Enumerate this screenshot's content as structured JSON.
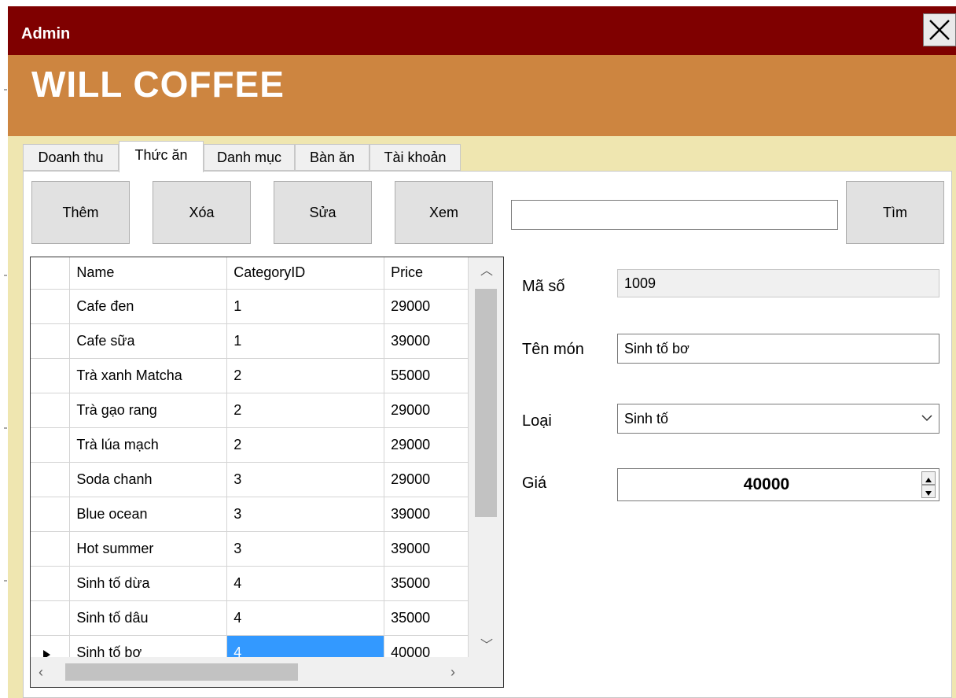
{
  "window": {
    "title": "Admin"
  },
  "banner": {
    "title": "WILL COFFEE"
  },
  "tabs": [
    {
      "label": "Doanh thu",
      "active": false
    },
    {
      "label": "Thức ăn",
      "active": true
    },
    {
      "label": "Danh mục",
      "active": false
    },
    {
      "label": "Bàn ăn",
      "active": false
    },
    {
      "label": "Tài khoản",
      "active": false
    }
  ],
  "toolbar": {
    "add_label": "Thêm",
    "delete_label": "Xóa",
    "edit_label": "Sửa",
    "view_label": "Xem",
    "search_value": "",
    "search_label": "Tìm"
  },
  "grid": {
    "columns": [
      "Name",
      "CategoryID",
      "Price"
    ],
    "rows": [
      [
        "Cafe đen",
        "1",
        "29000"
      ],
      [
        "Cafe sữa",
        "1",
        "39000"
      ],
      [
        "Trà xanh Matcha",
        "2",
        "55000"
      ],
      [
        "Trà gạo rang",
        "2",
        "29000"
      ],
      [
        "Trà lúa mạch",
        "2",
        "29000"
      ],
      [
        "Soda chanh",
        "3",
        "29000"
      ],
      [
        "Blue ocean",
        "3",
        "39000"
      ],
      [
        "Hot summer",
        "3",
        "39000"
      ],
      [
        "Sinh tố dừa",
        "4",
        "35000"
      ],
      [
        "Sinh tố dâu",
        "4",
        "35000"
      ],
      [
        "Sinh tố bơ",
        "4",
        "40000"
      ]
    ],
    "current_row": 10,
    "selected_column": 1
  },
  "form": {
    "id_label": "Mã số",
    "id_value": "1009",
    "name_label": "Tên món",
    "name_value": "Sinh tố bơ",
    "category_label": "Loại",
    "category_value": "Sinh tố",
    "price_label": "Giá",
    "price_value": "40000"
  },
  "colors": {
    "titlebar": "#7f0000",
    "banner": "#cd8540",
    "tab_strip": "#efe6b0",
    "selection": "#3399ff"
  }
}
